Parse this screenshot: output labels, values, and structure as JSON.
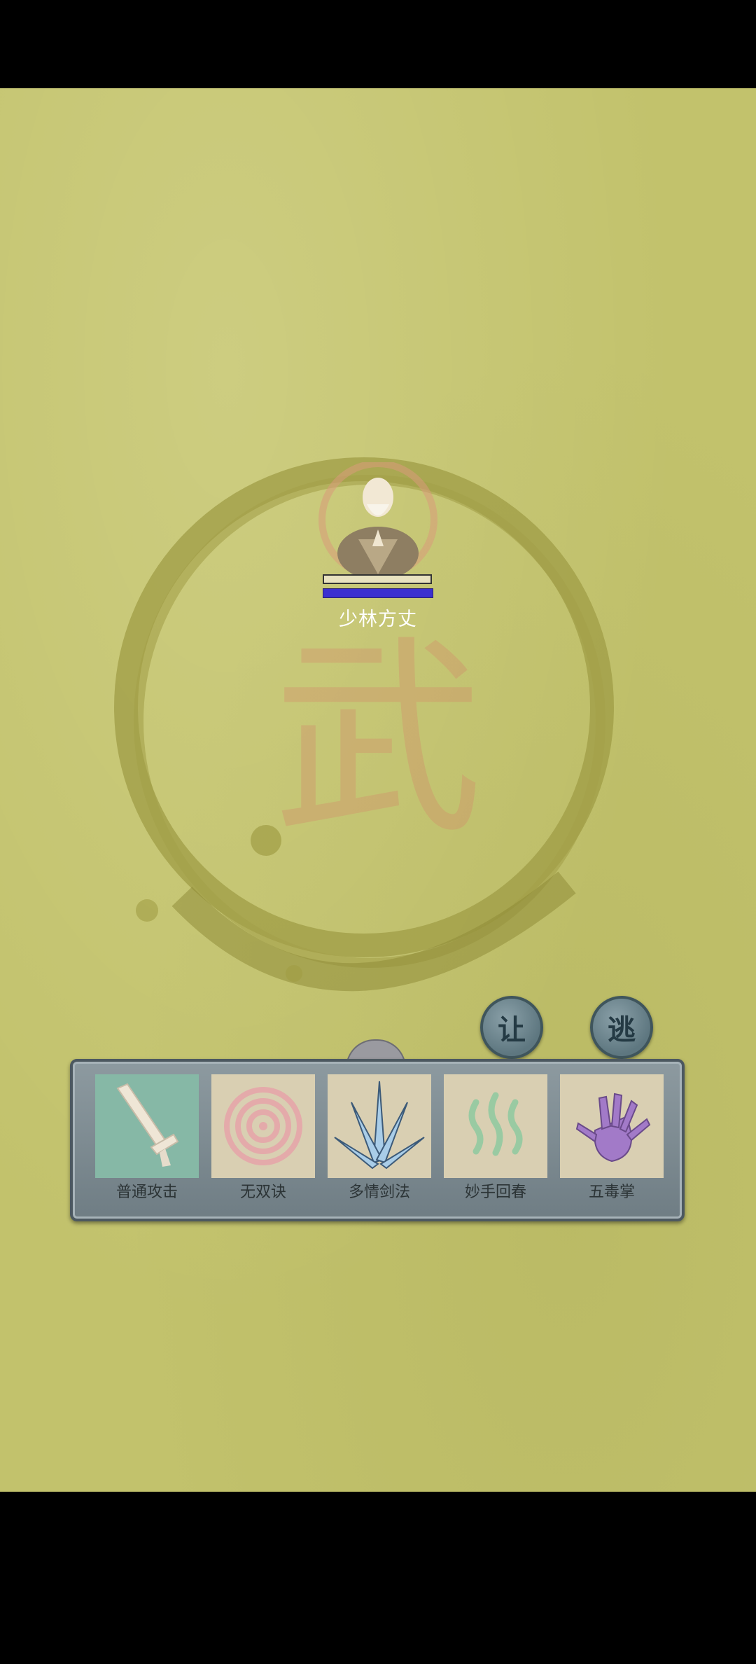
{
  "enemy": {
    "name": "少林方丈",
    "hp_fraction": 1.0,
    "mp_fraction": 1.0
  },
  "buttons": {
    "yield_label": "让",
    "flee_label": "逃"
  },
  "background": {
    "glyph": "武"
  },
  "skills": [
    {
      "label": "普通攻击",
      "icon": "sword-icon"
    },
    {
      "label": "无双诀",
      "icon": "spiral-icon"
    },
    {
      "label": "多情剑法",
      "icon": "blade-fan-icon"
    },
    {
      "label": "妙手回春",
      "icon": "healing-waves-icon"
    },
    {
      "label": "五毒掌",
      "icon": "poison-palm-icon"
    }
  ],
  "colors": {
    "arena": "#c2c26c",
    "mp_bar": "#3b2fd0",
    "panel": "#7c8a91"
  }
}
